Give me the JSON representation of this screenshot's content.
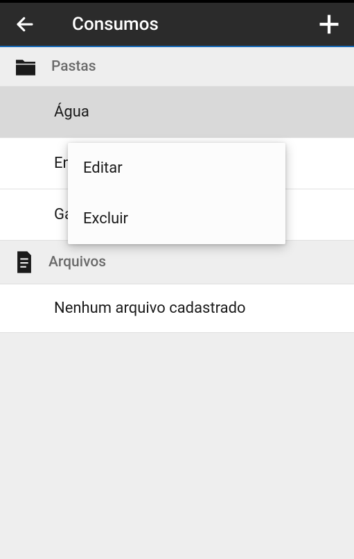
{
  "header": {
    "title": "Consumos"
  },
  "sections": {
    "folders": {
      "title": "Pastas",
      "items": [
        {
          "label": "Água"
        },
        {
          "label": "Energia"
        },
        {
          "label": "Gás"
        }
      ]
    },
    "files": {
      "title": "Arquivos",
      "emptyMessage": "Nenhum arquivo cadastrado"
    }
  },
  "contextMenu": {
    "edit": "Editar",
    "delete": "Excluir"
  }
}
